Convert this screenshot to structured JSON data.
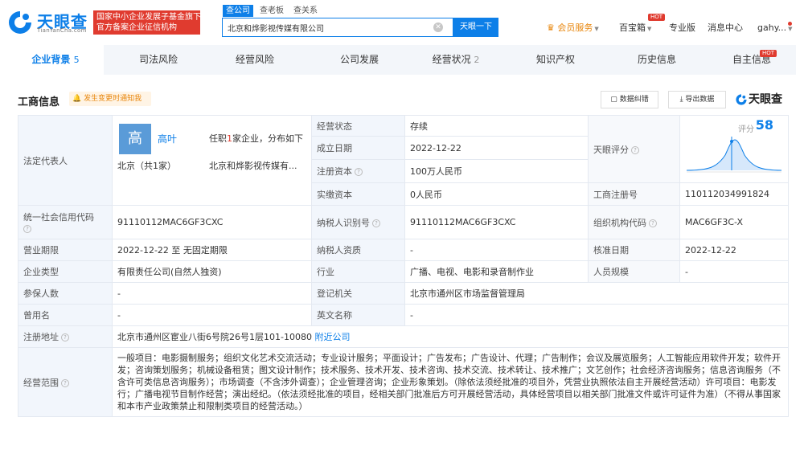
{
  "header": {
    "logo_cn": "天眼查",
    "logo_en": "TianYanCha.com",
    "badge_line1": "国家中小企业发展子基金旗下",
    "badge_line2": "官方备案企业征信机构",
    "search_tabs": [
      "查公司",
      "查老板",
      "查关系"
    ],
    "search_value": "北京和烨影视传媒有限公司",
    "search_button": "天眼一下",
    "nav": {
      "vip": "会员服务",
      "treasure": "百宝箱",
      "pro": "专业版",
      "messages": "消息中心",
      "user": "gahy...",
      "hot": "HOT"
    }
  },
  "tabs": [
    {
      "label": "企业背景",
      "count": "5",
      "active": true
    },
    {
      "label": "司法风险",
      "count": ""
    },
    {
      "label": "经营风险",
      "count": ""
    },
    {
      "label": "公司发展",
      "count": ""
    },
    {
      "label": "经营状况",
      "count": "2"
    },
    {
      "label": "知识产权",
      "count": ""
    },
    {
      "label": "历史信息",
      "count": ""
    },
    {
      "label": "自主信息",
      "count": "",
      "hot": "HOT"
    }
  ],
  "section": {
    "title": "工商信息",
    "notice": "发生变更时通知我",
    "correct_btn": "数据纠错",
    "export_btn": "导出数据",
    "brand": "天眼查"
  },
  "legal": {
    "label": "法定代表人",
    "avatar": "高",
    "name": "高叶",
    "info_prefix": "任职",
    "info_num": "1",
    "info_suffix": "家企业，分布如下",
    "location": "北京（共1家）",
    "company": "北京和烨影视传媒有..."
  },
  "rows": {
    "status_label": "经营状态",
    "status": "存续",
    "setup_label": "成立日期",
    "setup": "2022-12-22",
    "capital_label": "注册资本",
    "capital": "100万人民币",
    "paid_label": "实缴资本",
    "paid": "0人民币",
    "score_label": "天眼评分",
    "score_text": "评分",
    "score": "58",
    "regno_label": "工商注册号",
    "regno": "110112034991824",
    "credit_label": "统一社会信用代码",
    "credit": "91110112MAC6GF3CXC",
    "taxid_label": "纳税人识别号",
    "taxid": "91110112MAC6GF3CXC",
    "org_label": "组织机构代码",
    "org": "MAC6GF3C-X",
    "term_label": "营业期限",
    "term": "2022-12-22 至 无固定期限",
    "taxq_label": "纳税人资质",
    "taxq": "-",
    "approve_label": "核准日期",
    "approve": "2022-12-22",
    "type_label": "企业类型",
    "type": "有限责任公司(自然人独资)",
    "industry_label": "行业",
    "industry": "广播、电视、电影和录音制作业",
    "staff_label": "人员规模",
    "staff": "-",
    "insured_label": "参保人数",
    "insured": "-",
    "authority_label": "登记机关",
    "authority": "北京市通州区市场监督管理局",
    "former_label": "曾用名",
    "former": "-",
    "english_label": "英文名称",
    "english": "-",
    "addr_label": "注册地址",
    "addr": "北京市通州区宦业八街6号院26号1层101-10080",
    "addr_link": "附近公司",
    "scope_label": "经营范围",
    "scope": "一般项目：电影摄制服务；组织文化艺术交流活动；专业设计服务；平面设计；广告发布；广告设计、代理；广告制作；会议及展览服务；人工智能应用软件开发；软件开发；咨询策划服务；机械设备租赁；图文设计制作；技术服务、技术开发、技术咨询、技术交流、技术转让、技术推广；文艺创作；社会经济咨询服务；信息咨询服务（不含许可类信息咨询服务）；市场调查（不含涉外调查）；企业管理咨询；企业形象策划。（除依法须经批准的项目外，凭营业执照依法自主开展经营活动）许可项目：电影发行；广播电视节目制作经营；演出经纪。（依法须经批准的项目，经相关部门批准后方可开展经营活动，具体经营项目以相关部门批准文件或许可证件为准）（不得从事国家和本市产业政策禁止和限制类项目的经营活动。）"
  },
  "colors": {
    "accent": "#0d7fe8",
    "badge": "#e03b2f",
    "vip": "#e8860c"
  }
}
